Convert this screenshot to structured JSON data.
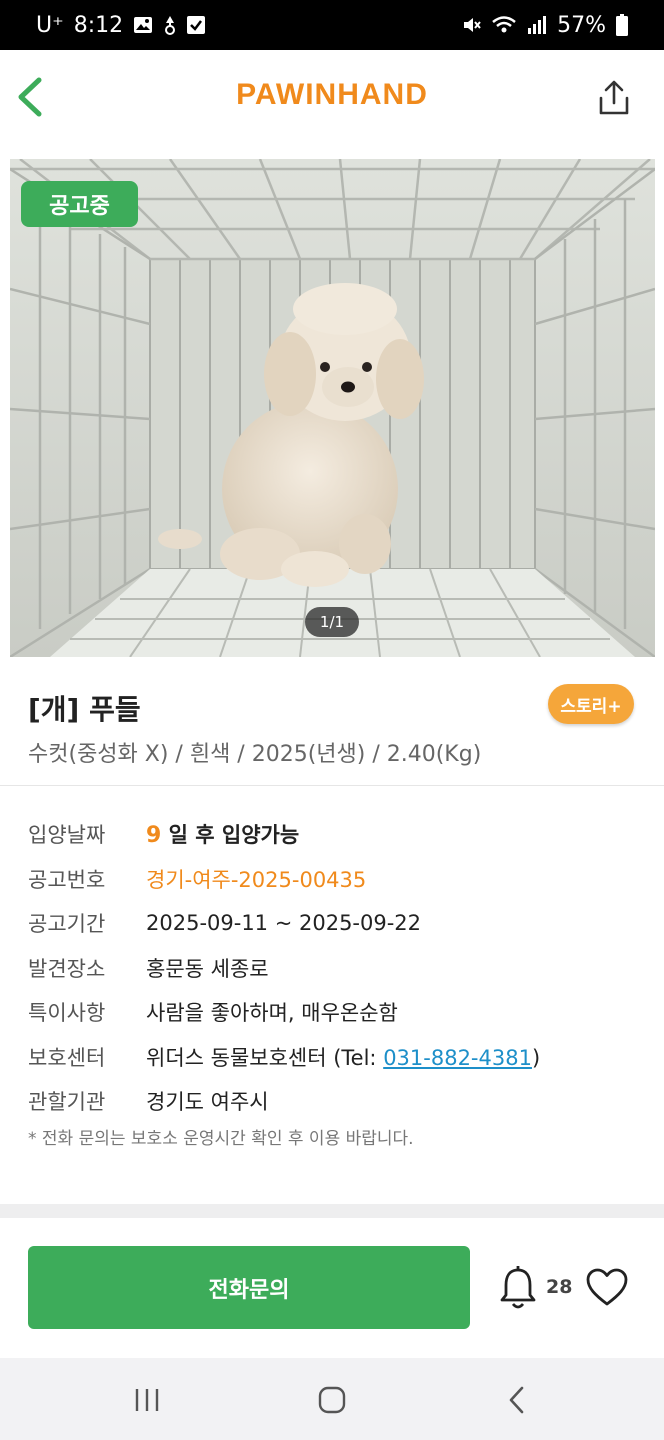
{
  "status_bar": {
    "carrier": "U⁺",
    "time": "8:12",
    "battery": "57%",
    "icons": [
      "gallery-icon",
      "data-saver-icon",
      "checkbox-icon",
      "mute-icon",
      "wifi-icon",
      "signal-icon",
      "battery-icon"
    ]
  },
  "header": {
    "brand": "PAWINHAND",
    "brand_color": "#f08a1c",
    "back_icon": "chevron-left-icon",
    "share_icon": "share-icon"
  },
  "photo": {
    "status_chip": "공고중",
    "page_indicator": "1/1"
  },
  "pet": {
    "title": "[개] 푸들",
    "summary": "수컷(중성화 X) / 흰색 / 2025(년생) / 2.40(Kg)",
    "story_button": "스토리+"
  },
  "details": {
    "adoption_date_label": "입양날짜",
    "adoption_days": "9",
    "adoption_suffix": "일 후 입양가능",
    "notice_no_label": "공고번호",
    "notice_no": "경기-여주-2025-00435",
    "period_label": "공고기간",
    "period": "2025-09-11 ~ 2025-09-22",
    "found_place_label": "발견장소",
    "found_place": "홍문동 세종로",
    "special_label": "특이사항",
    "special": "사람을 좋아하며, 매우온순함",
    "center_label": "보호센터",
    "center_name": "위더스 동물보호센터 (Tel: ",
    "center_tel": "031-882-4381",
    "center_close": ")",
    "agency_label": "관할기관",
    "agency": "경기도 여주시",
    "notice_text": "* 전화 문의는 보호소 운영시간 확인 후 이용 바랍니다."
  },
  "actions": {
    "call_button": "전화문의",
    "alarm_count": "28",
    "accent_green": "#3dac5a"
  },
  "nav": {
    "recent_icon": "recent-apps-icon",
    "home_icon": "home-icon",
    "back_icon": "nav-back-icon"
  }
}
